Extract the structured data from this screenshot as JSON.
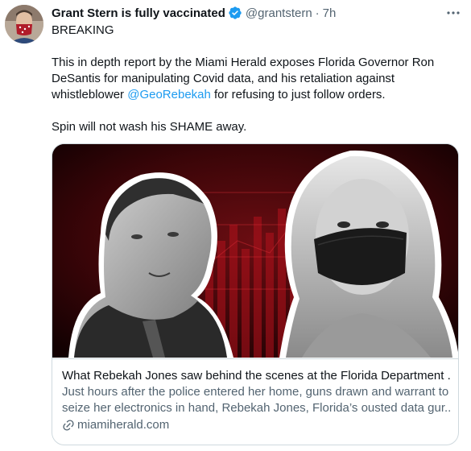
{
  "tweet": {
    "display_name": "Grant Stern is fully vaccinated",
    "handle": "@grantstern",
    "separator": "·",
    "time": "7h",
    "lines": [
      "BREAKING",
      "",
      "This in depth report by the Miami Herald exposes Florida Governor Ron",
      "DeSantis for manipulating Covid data, and his retaliation against"
    ],
    "whistle_prefix": "whistleblower ",
    "mention": "@GeoRebekah",
    "whistle_suffix": " for refusing to just follow orders.",
    "closing": "Spin will not wash his SHAME away."
  },
  "card": {
    "title": "What Rebekah Jones saw behind the scenes at the Florida Department ...",
    "desc_line1": "Just hours after the police entered her home, guns drawn and warrant to",
    "desc_line2": "seize her electronics in hand, Rebekah Jones, Florida’s ousted data gur...",
    "domain": "miamiherald.com"
  },
  "colors": {
    "link": "#1d9bf0",
    "text": "#0f1419",
    "muted": "#536471",
    "border": "#cfd9de",
    "chart_red": "#b3121c"
  },
  "icons": [
    "avatar-photo",
    "verified-badge-icon",
    "more-icon",
    "link-icon"
  ]
}
